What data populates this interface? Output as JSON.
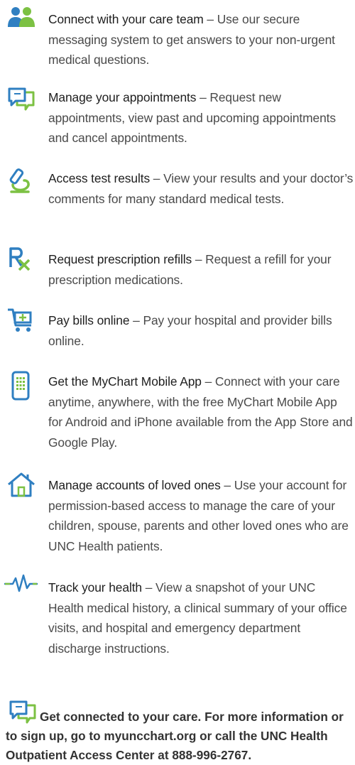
{
  "features": [
    {
      "icon": "care-team-icon",
      "title": "Connect with your care team",
      "desc": " – Use our secure messaging system to get answers to your non-urgent medical questions."
    },
    {
      "icon": "chat-bubbles-icon",
      "title": "Manage your appointments",
      "desc": " – Request new appointments, view past and upcoming appointments and cancel appointments."
    },
    {
      "icon": "test-results-icon",
      "title": "Access test results",
      "desc": " – View your results and your doctor’s comments for many standard medical tests."
    },
    {
      "icon": "prescription-icon",
      "title": "Request prescription refills",
      "desc": " – Request a refill for your prescription medications."
    },
    {
      "icon": "shopping-cart-icon",
      "title": "Pay bills online",
      "desc": " – Pay your hospital and provider bills online."
    },
    {
      "icon": "mobile-phone-icon",
      "title": "Get the MyChart Mobile App",
      "desc": " – Connect with your care anytime, anywhere, with the free MyChart Mobile App for Android and iPhone available from the App Store and Google Play."
    },
    {
      "icon": "house-icon",
      "title": "Manage accounts of loved ones",
      "desc": " – Use your account for permission-based access to manage the care of your children, spouse, parents and other loved ones who are UNC Health patients."
    },
    {
      "icon": "heartbeat-icon",
      "title": "Track your health",
      "desc": " – View a snapshot of your UNC Health medical history, a clinical summary of your office visits, and hospital and emergency department discharge instructions."
    }
  ],
  "footer": {
    "icon": "chat-bubbles-icon",
    "text": "Get connected to your care. For more information or to sign up, go to myuncchart.org or call the UNC Health Outpatient Access Center at 888-996-2767."
  },
  "colors": {
    "blue": "#2f7fc1",
    "green": "#7cc143",
    "text": "#4a4a4a",
    "title": "#1e1e1e"
  }
}
